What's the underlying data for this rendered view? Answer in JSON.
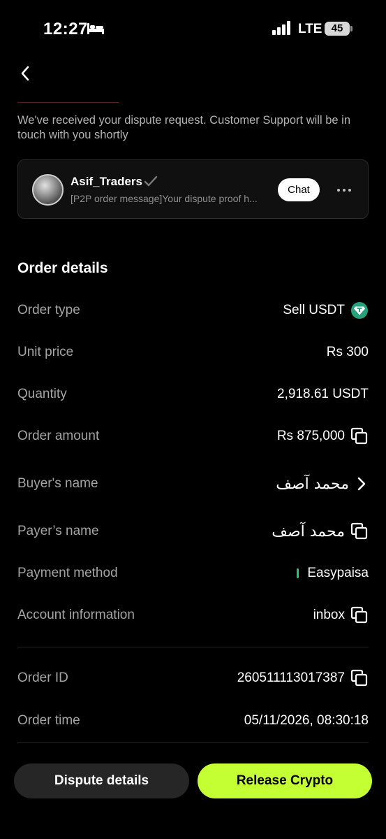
{
  "status_bar": {
    "time": "12:27",
    "network": "LTE",
    "battery": "45"
  },
  "dispute_message": "We've received your dispute request. Customer Support will be in touch with you shortly",
  "chat": {
    "name": "Asif_Traders",
    "preview": "[P2P order message]Your dispute proof h...",
    "chat_label": "Chat"
  },
  "order": {
    "title": "Order details",
    "rows": [
      {
        "label": "Order type",
        "value": "Sell USDT"
      },
      {
        "label": "Unit price",
        "value": "Rs 300"
      },
      {
        "label": "Quantity",
        "value": "2,918.61 USDT"
      },
      {
        "label": "Order amount",
        "value": "Rs 875,000"
      },
      {
        "label": "Buyer's name",
        "value": "محمد آصف"
      },
      {
        "label": "Payer’s name",
        "value": "محمد آصف"
      },
      {
        "label": "Payment method",
        "value": "Easypaisa"
      },
      {
        "label": "Account information",
        "value": "inbox"
      }
    ],
    "id_row": {
      "label": "Order ID",
      "value": "260511113017387"
    },
    "time_row": {
      "label": "Order time",
      "value": "05/11/2026, 08:30:18"
    }
  },
  "actions": {
    "dispute_label": "Dispute details",
    "release_label": "Release Crypto"
  },
  "colors": {
    "accent": "#c4ff33",
    "payment_marker": "#29c47a",
    "usdt": "#26a17b"
  }
}
